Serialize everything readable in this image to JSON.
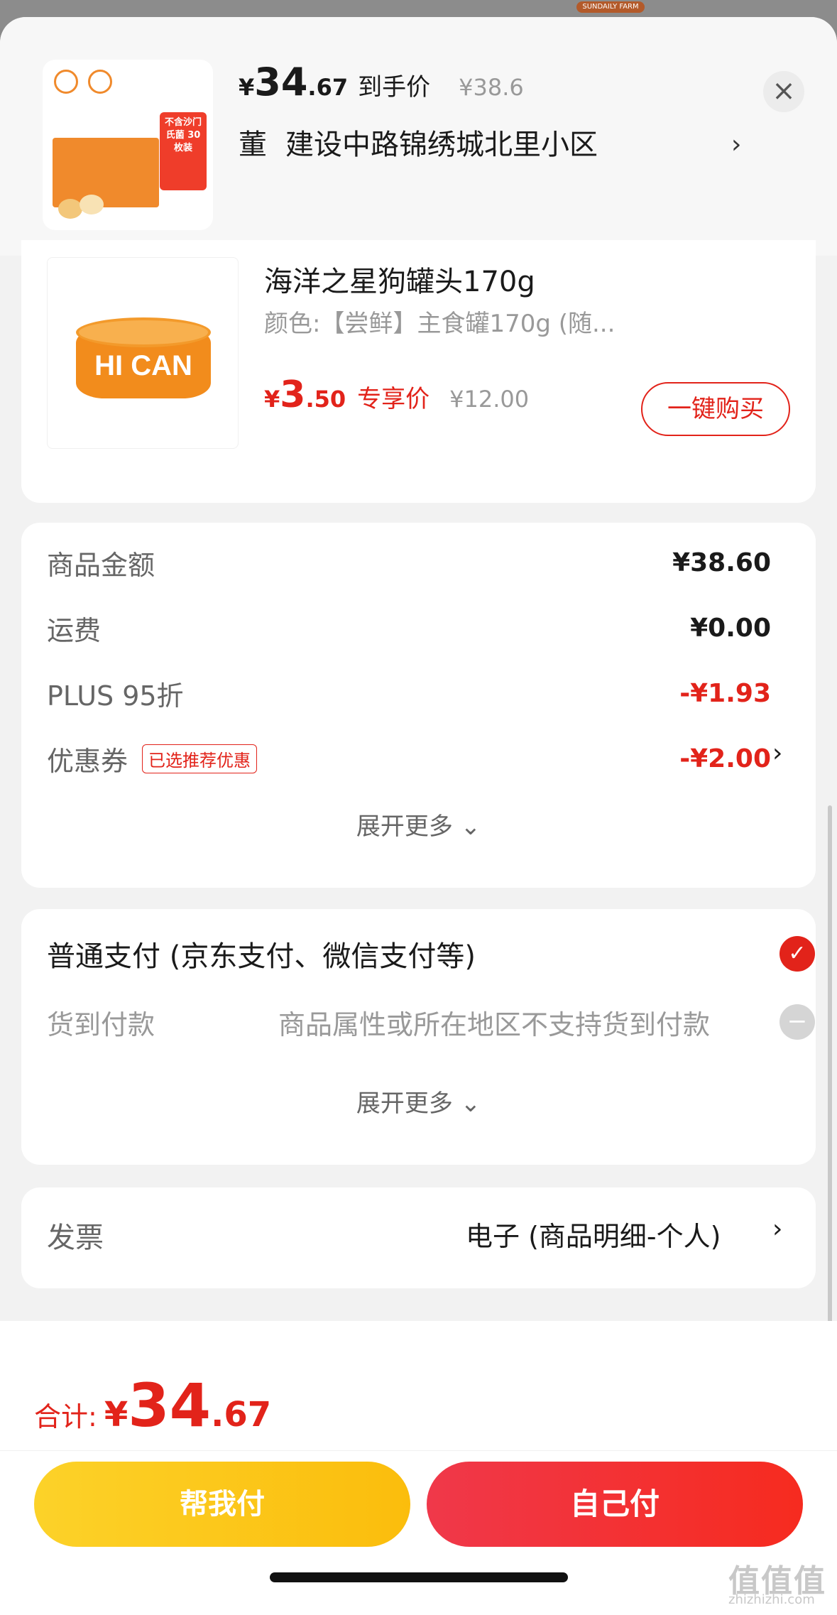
{
  "background_badge": "SUNDAILY FARM",
  "header": {
    "price_currency": "¥",
    "price_int": "34",
    "price_dec": ".67",
    "price_tag": "到手价",
    "original_price": "¥38.6",
    "recipient": "董",
    "address": "建设中路锦绣城北里小区",
    "chevron": "›",
    "close_label": "×",
    "product_badge_text": "不含沙门氏菌 30枚装"
  },
  "recommended": {
    "title": "海洋之星狗罐头170g",
    "spec": "颜色:【尝鲜】主食罐170g (随...",
    "can_text": "HI CAN",
    "price_currency": "¥",
    "price_int": "3",
    "price_dec": ".50",
    "price_tag": "专享价",
    "original_price": "¥12.00",
    "buy_label": "一键购买"
  },
  "summary": {
    "rows": [
      {
        "label": "商品金额",
        "value": "¥38.60"
      },
      {
        "label": "运费",
        "value": "¥0.00"
      },
      {
        "label": "PLUS 95折",
        "value": "-¥1.93"
      },
      {
        "label": "优惠券",
        "badge": "已选推荐优惠",
        "value": "-¥2.00",
        "chevron": "›"
      }
    ],
    "expand_label": "展开更多 ⌄"
  },
  "payment": {
    "main_option": "普通支付 (京东支付、微信支付等)",
    "check_icon": "✓",
    "cod_label": "货到付款",
    "cod_note": "商品属性或所在地区不支持货到付款",
    "minus_icon": "−",
    "expand_label": "展开更多 ⌄"
  },
  "invoice": {
    "label": "发票",
    "value": "电子 (商品明细-个人)",
    "chevron": "›"
  },
  "footer": {
    "total_label": "合计:",
    "total_currency": "¥",
    "total_int": "34",
    "total_dec": ".67",
    "help_pay_label": "帮我付",
    "self_pay_label": "自己付"
  },
  "watermark": {
    "text": "值值值",
    "site": "zhizhizhi.com"
  },
  "colors": {
    "accent_red": "#e2231a",
    "help_button": "#fbbd0c",
    "self_button": "#f62b1f"
  }
}
